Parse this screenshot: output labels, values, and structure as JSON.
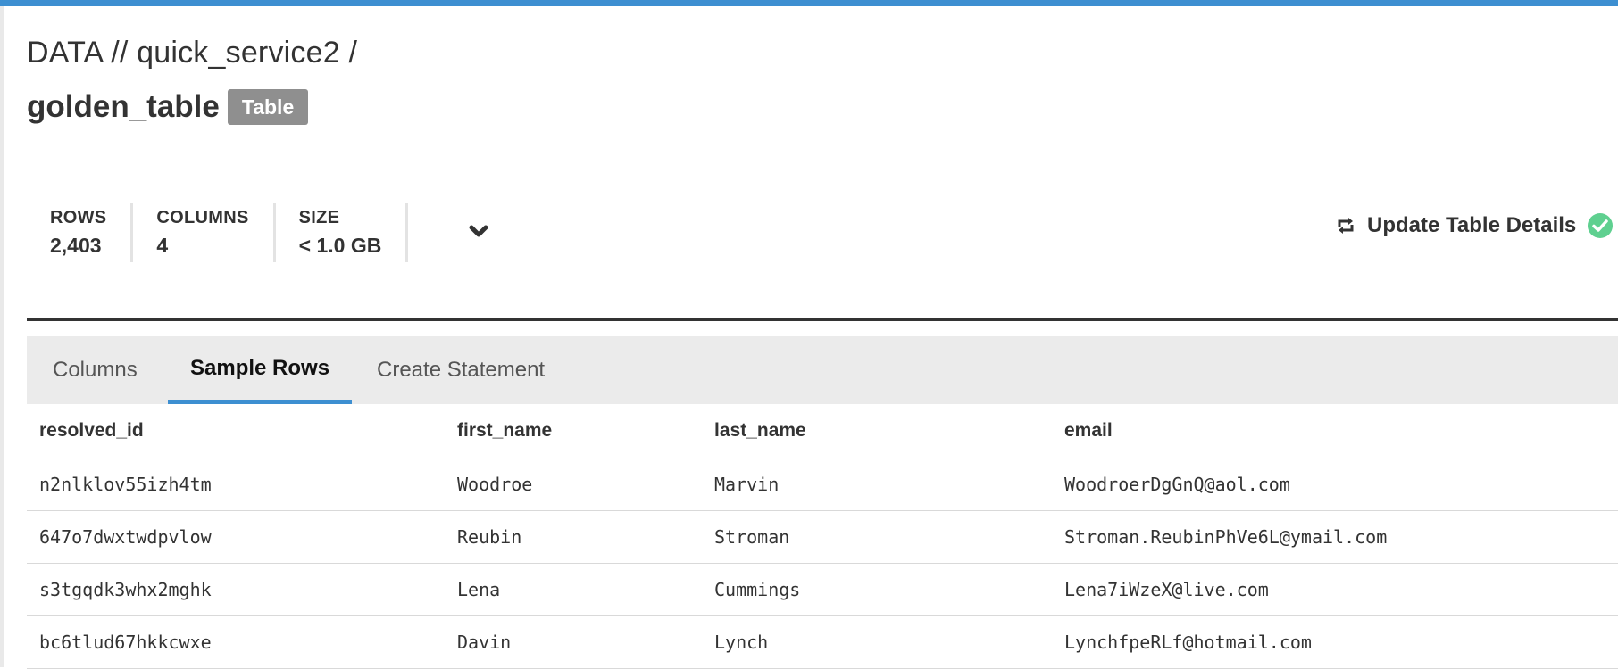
{
  "breadcrumb": "DATA // quick_service2 /",
  "title": "golden_table",
  "type_badge": "Table",
  "stats": [
    {
      "label": "ROWS",
      "value": "2,403"
    },
    {
      "label": "COLUMNS",
      "value": "4"
    },
    {
      "label": "SIZE",
      "value": "< 1.0 GB"
    }
  ],
  "update_button": {
    "label": "Update Table Details",
    "status": "success"
  },
  "tabs": [
    {
      "label": "Columns",
      "active": false
    },
    {
      "label": "Sample Rows",
      "active": true
    },
    {
      "label": "Create Statement",
      "active": false
    }
  ],
  "table": {
    "headers": [
      "resolved_id",
      "first_name",
      "last_name",
      "email"
    ],
    "rows": [
      [
        "n2nlklov55izh4tm",
        "Woodroe",
        "Marvin",
        "WoodroerDgGnQ@aol.com"
      ],
      [
        "647o7dwxtwdpvlow",
        "Reubin",
        "Stroman",
        "Stroman.ReubinPhVe6L@ymail.com"
      ],
      [
        "s3tgqdk3whx2mghk",
        "Lena",
        "Cummings",
        "Lena7iWzeX@live.com"
      ],
      [
        "bc6tlud67hkkcwxe",
        "Davin",
        "Lynch",
        "LynchfpeRLf@hotmail.com"
      ]
    ]
  },
  "colors": {
    "accent": "#3d8fd1",
    "badge": "#8f8f8f",
    "success": "#5fd090",
    "tabbar_bg": "#ebebeb"
  },
  "icons": {
    "expand": "chevron-down-icon",
    "refresh": "refresh-icon",
    "status": "check-circle-icon"
  }
}
